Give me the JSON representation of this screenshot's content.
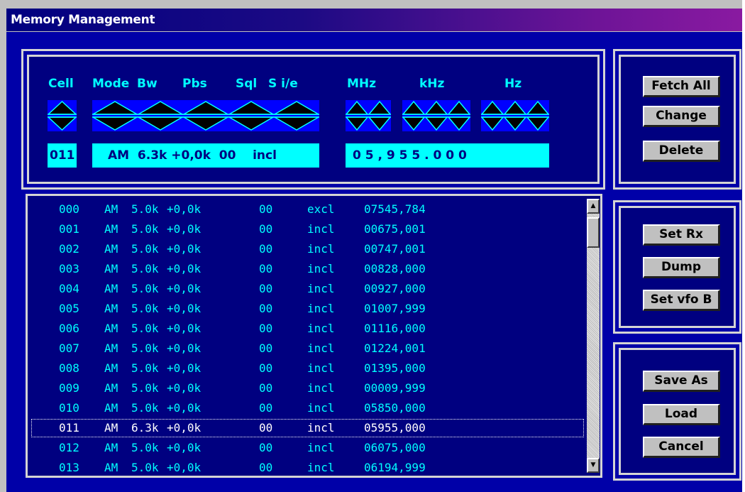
{
  "window": {
    "title": "Memory Management"
  },
  "editor": {
    "headers": {
      "cell": "Cell",
      "mode": "Mode",
      "bw": "Bw",
      "pbs": "Pbs",
      "sql": "Sql",
      "sie": "S i/e",
      "mhz": "MHz",
      "khz": "kHz",
      "hz": "Hz"
    },
    "values": {
      "cell": "011",
      "mode_bw_pbs_sql_sie": "AM  6.3k +0,0k  00    incl",
      "frequency": "0 5 , 9 5 5 . 0 0 0"
    }
  },
  "buttons": {
    "fetch_all": "Fetch All",
    "change": "Change",
    "delete": "Delete",
    "set_rx": "Set Rx",
    "dump": "Dump",
    "set_vfo_b": "Set vfo B",
    "save_as": "Save As",
    "load": "Load",
    "cancel": "Cancel"
  },
  "memory_list": {
    "selected_index": 11,
    "rows": [
      {
        "cell": "000",
        "mode": "AM",
        "bw": "5.0k",
        "pbs": "+0,0k",
        "sql": "00",
        "sie": "excl",
        "freq": "07545,784"
      },
      {
        "cell": "001",
        "mode": "AM",
        "bw": "5.0k",
        "pbs": "+0,0k",
        "sql": "00",
        "sie": "incl",
        "freq": "00675,001"
      },
      {
        "cell": "002",
        "mode": "AM",
        "bw": "5.0k",
        "pbs": "+0,0k",
        "sql": "00",
        "sie": "incl",
        "freq": "00747,001"
      },
      {
        "cell": "003",
        "mode": "AM",
        "bw": "5.0k",
        "pbs": "+0,0k",
        "sql": "00",
        "sie": "incl",
        "freq": "00828,000"
      },
      {
        "cell": "004",
        "mode": "AM",
        "bw": "5.0k",
        "pbs": "+0,0k",
        "sql": "00",
        "sie": "incl",
        "freq": "00927,000"
      },
      {
        "cell": "005",
        "mode": "AM",
        "bw": "5.0k",
        "pbs": "+0,0k",
        "sql": "00",
        "sie": "incl",
        "freq": "01007,999"
      },
      {
        "cell": "006",
        "mode": "AM",
        "bw": "5.0k",
        "pbs": "+0,0k",
        "sql": "00",
        "sie": "incl",
        "freq": "01116,000"
      },
      {
        "cell": "007",
        "mode": "AM",
        "bw": "5.0k",
        "pbs": "+0,0k",
        "sql": "00",
        "sie": "incl",
        "freq": "01224,001"
      },
      {
        "cell": "008",
        "mode": "AM",
        "bw": "5.0k",
        "pbs": "+0,0k",
        "sql": "00",
        "sie": "incl",
        "freq": "01395,000"
      },
      {
        "cell": "009",
        "mode": "AM",
        "bw": "5.0k",
        "pbs": "+0,0k",
        "sql": "00",
        "sie": "incl",
        "freq": "00009,999"
      },
      {
        "cell": "010",
        "mode": "AM",
        "bw": "5.0k",
        "pbs": "+0,0k",
        "sql": "00",
        "sie": "incl",
        "freq": "05850,000"
      },
      {
        "cell": "011",
        "mode": "AM",
        "bw": "6.3k",
        "pbs": "+0,0k",
        "sql": "00",
        "sie": "incl",
        "freq": "05955,000"
      },
      {
        "cell": "012",
        "mode": "AM",
        "bw": "5.0k",
        "pbs": "+0,0k",
        "sql": "00",
        "sie": "incl",
        "freq": "06075,000"
      },
      {
        "cell": "013",
        "mode": "AM",
        "bw": "5.0k",
        "pbs": "+0,0k",
        "sql": "00",
        "sie": "incl",
        "freq": "06194,999"
      }
    ]
  },
  "icons": {
    "spinner": "up-down-spinner-icon",
    "scroll_up": "scroll-up-arrow-icon",
    "scroll_down": "scroll-down-arrow-icon"
  },
  "colors": {
    "background": "#0000a8",
    "panel": "#000080",
    "text_cyan": "#00ffff",
    "spinner_bg": "#0000ff",
    "spinner_fill": "#000000"
  }
}
